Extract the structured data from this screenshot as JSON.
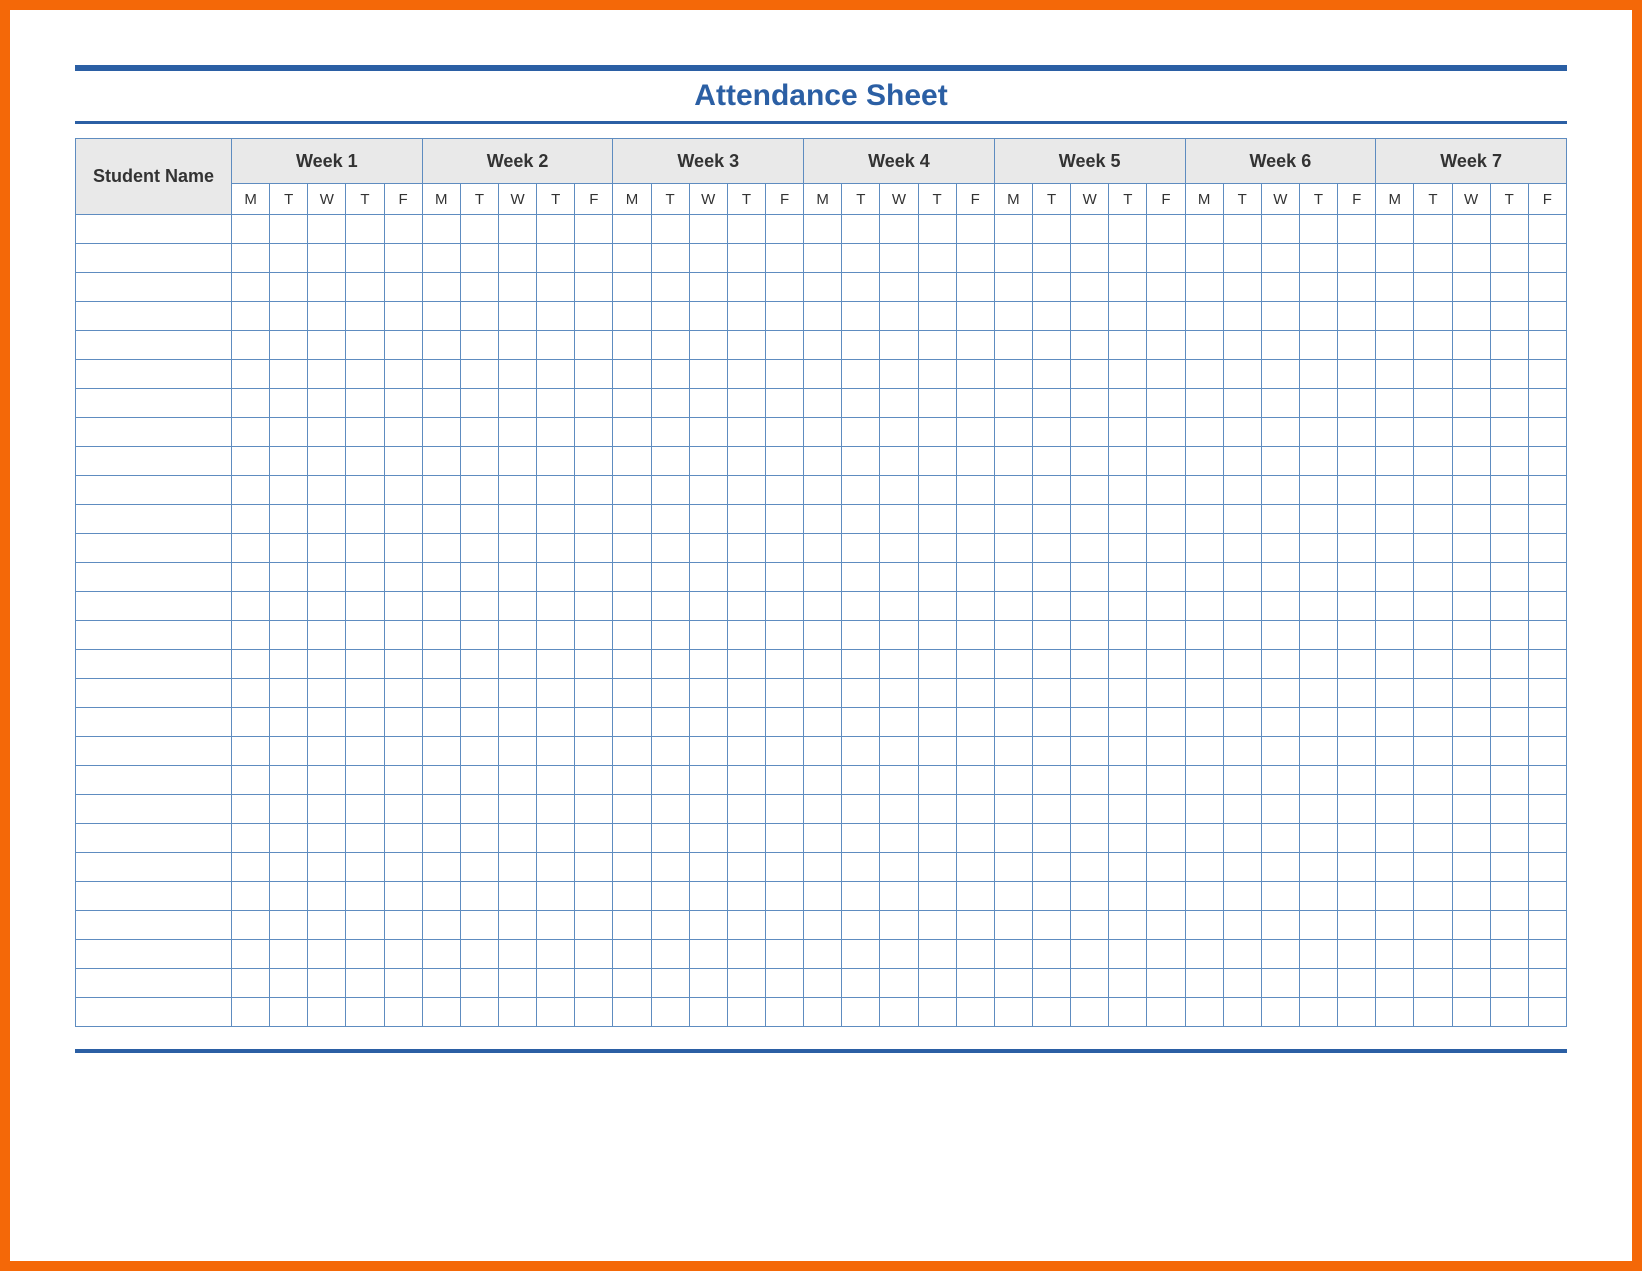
{
  "title": "Attendance Sheet",
  "columns": {
    "name_header": "Student Name",
    "weeks": [
      {
        "label": "Week 1",
        "days": [
          "M",
          "T",
          "W",
          "T",
          "F"
        ]
      },
      {
        "label": "Week 2",
        "days": [
          "M",
          "T",
          "W",
          "T",
          "F"
        ]
      },
      {
        "label": "Week 3",
        "days": [
          "M",
          "T",
          "W",
          "T",
          "F"
        ]
      },
      {
        "label": "Week 4",
        "days": [
          "M",
          "T",
          "W",
          "T",
          "F"
        ]
      },
      {
        "label": "Week 5",
        "days": [
          "M",
          "T",
          "W",
          "T",
          "F"
        ]
      },
      {
        "label": "Week 6",
        "days": [
          "M",
          "T",
          "W",
          "T",
          "F"
        ]
      },
      {
        "label": "Week 7",
        "days": [
          "M",
          "T",
          "W",
          "T",
          "F"
        ]
      }
    ]
  },
  "row_count": 28,
  "colors": {
    "frame": "#f46808",
    "accent": "#2b5fa4",
    "grid": "#5e8cc0",
    "header_bg": "#e9e9e9"
  }
}
